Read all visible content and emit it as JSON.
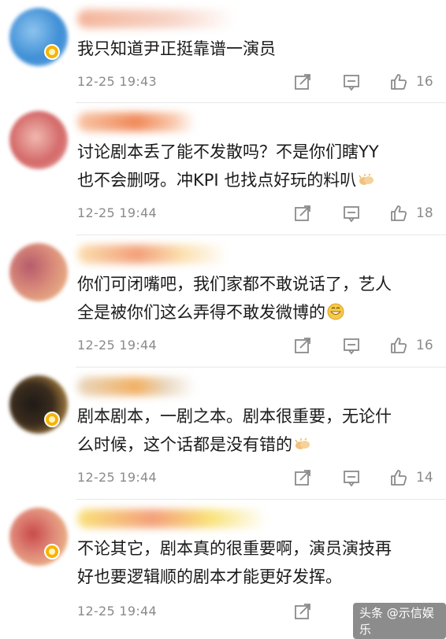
{
  "comments": [
    {
      "username": "",
      "text_line1": "我只知道尹正挺靠谱一演员",
      "text_line2": "",
      "emoji": "",
      "time": "12-25 19:43",
      "likes": "16",
      "avatar_colors": [
        "#3f8fd6",
        "#8ec4ee"
      ],
      "name_colors": [
        "#f4b49a",
        "#f7d5c8"
      ],
      "verified": true
    },
    {
      "username": "",
      "text_line1": "讨论剧本丢了能不发散吗？不是你们瞎YY",
      "text_line2": "也不会删呀。冲KPI 也找点好玩的料叭",
      "emoji": "clap",
      "time": "12-25 19:44",
      "likes": "18",
      "avatar_colors": [
        "#d46a6a",
        "#f1b9b0"
      ],
      "name_colors": [
        "#f08a5a",
        "#f8c6a8"
      ],
      "verified": false
    },
    {
      "username": "",
      "text_line1": "你们可闭嘴吧，我们家都不敢说话了，艺人",
      "text_line2": "全是被你们这么弄得不敢发微博的",
      "emoji": "grin",
      "time": "12-25 19:44",
      "likes": "16",
      "avatar_colors": [
        "#b65b6b",
        "#f0c38a"
      ],
      "name_colors": [
        "#f3a07a",
        "#fbe0b0"
      ],
      "verified": false
    },
    {
      "username": "",
      "text_line1": "剧本剧本，一剧之本。剧本很重要，无论什",
      "text_line2": "么时候，这个话都是没有错的",
      "emoji": "clap",
      "time": "12-25 19:44",
      "likes": "14",
      "avatar_colors": [
        "#1e1a16",
        "#d7a34a"
      ],
      "name_colors": [
        "#f2b064",
        "#e9d8c0"
      ],
      "verified": true
    },
    {
      "username": "",
      "text_line1": "不论其它，剧本真的很重要啊，演员演技再",
      "text_line2": "好也要逻辑顺的剧本才能更好发挥。",
      "emoji": "",
      "time": "12-25 19:44",
      "likes": "",
      "avatar_colors": [
        "#c94a4a",
        "#f0d08a"
      ],
      "name_colors": [
        "#f4a07a",
        "#f9e27a"
      ],
      "verified": true
    }
  ],
  "icons": {
    "share": "share-icon",
    "reply": "comment-icon",
    "like": "thumbs-up-icon"
  },
  "watermark": "头条 @示信娱乐",
  "colors": {
    "text": "#1a1a1a",
    "meta": "#8a8a8a",
    "divider": "#e8e8e8"
  }
}
